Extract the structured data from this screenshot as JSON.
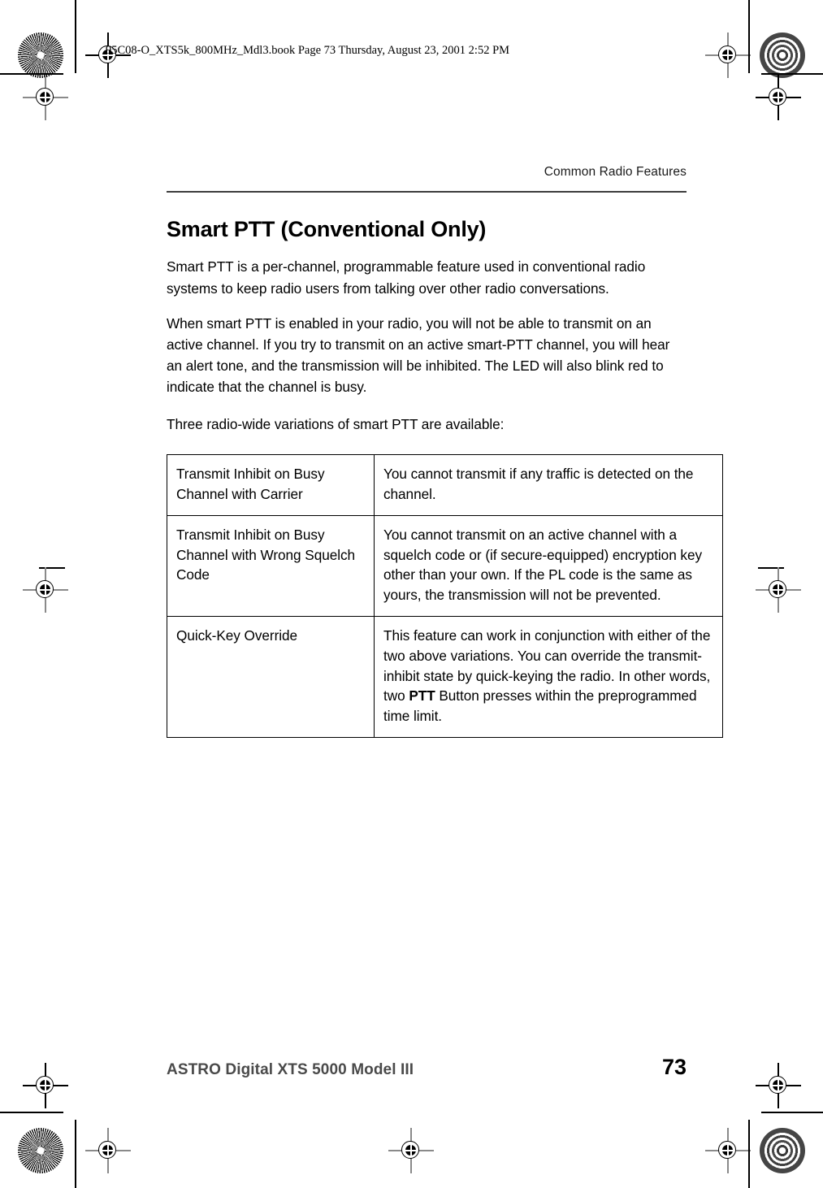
{
  "page": {
    "file_stamp": "95C08-O_XTS5k_800MHz_Mdl3.book  Page 73  Thursday, August 23, 2001  2:52 PM",
    "running_head": "Common Radio Features",
    "section_title": "Smart PTT (Conventional Only)",
    "paragraphs": [
      "Smart PTT is a per-channel, programmable feature used in conventional radio systems to keep radio users from talking over other radio conversations.",
      "When smart PTT is enabled in your radio, you will not be able to transmit on an active channel. If you try to transmit on an active smart-PTT channel, you will hear an alert tone, and the transmission will be inhibited. The LED will also blink red to indicate that the channel is busy.",
      "Three radio-wide variations of smart PTT are available:"
    ]
  },
  "table": {
    "rows": [
      {
        "term": "Transmit Inhibit on Busy Channel with Carrier",
        "description": "You cannot transmit if any traffic is detected on the channel.",
        "desc_pre": "You cannot transmit if any traffic is detected on the channel.",
        "desc_bold": "",
        "desc_post": ""
      },
      {
        "term": "Transmit Inhibit on Busy Channel with Wrong Squelch Code",
        "description": "You cannot transmit on an active channel with a squelch code or (if secure-equipped) encryption key other than your own. If the PL code is the same as yours, the transmission will not be prevented.",
        "desc_pre": "You cannot transmit on an active channel with a squelch code or (if secure-equipped) encryption key other than your own. If the PL code is the same as yours, the transmission will not be prevented.",
        "desc_bold": "",
        "desc_post": ""
      },
      {
        "term": "Quick-Key Override",
        "description": "This feature can work in conjunction with either of the two above variations. You can override the transmit-inhibit state by quick-keying the radio. In other words, two PTT Button presses within the preprogrammed time limit.",
        "desc_pre": "This feature can work in conjunction with either of the two above variations. You can override the transmit-inhibit state by quick-keying the radio. In other words, two ",
        "desc_bold": "PTT",
        "desc_post": " Button presses within the preprogrammed time limit."
      }
    ]
  },
  "footer": {
    "doc_title": "ASTRO Digital XTS 5000 Model III",
    "page_number": "73"
  },
  "colors": {
    "rule": "#3d3d3d",
    "footer_title": "#4a4a4a",
    "text": "#000000"
  }
}
